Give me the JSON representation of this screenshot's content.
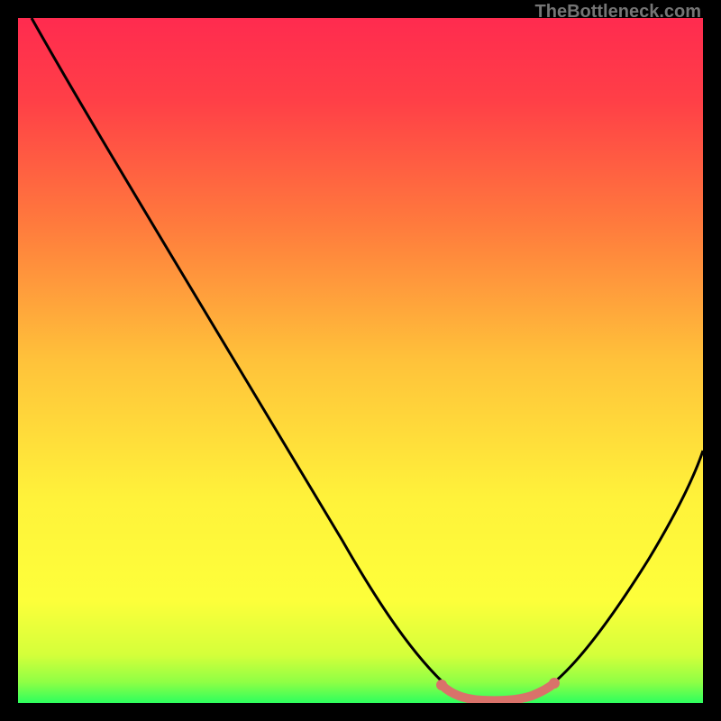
{
  "attribution": "TheBottleneck.com",
  "chart_data": {
    "type": "line",
    "title": "",
    "xlabel": "",
    "ylabel": "",
    "xlim": [
      0,
      100
    ],
    "ylim": [
      0,
      100
    ],
    "background_gradient": {
      "top": "#ff2b4f",
      "mid_upper": "#ff8c3a",
      "mid": "#ffdf3a",
      "mid_lower": "#fff93a",
      "bottom": "#2dff5e"
    },
    "series": [
      {
        "name": "bottleneck-curve",
        "color": "#000000",
        "x": [
          2,
          10,
          20,
          30,
          40,
          50,
          58,
          62,
          66,
          70,
          74,
          78,
          82,
          90,
          100
        ],
        "y": [
          100,
          87,
          71,
          55,
          39,
          23,
          10,
          4,
          1,
          0,
          0,
          1,
          4,
          18,
          40
        ]
      },
      {
        "name": "optimal-region",
        "color": "#d9726a",
        "x": [
          62,
          66,
          70,
          74,
          78
        ],
        "y": [
          2,
          0.5,
          0,
          0.5,
          2
        ]
      }
    ],
    "optimal_x_range": [
      62,
      78
    ]
  }
}
